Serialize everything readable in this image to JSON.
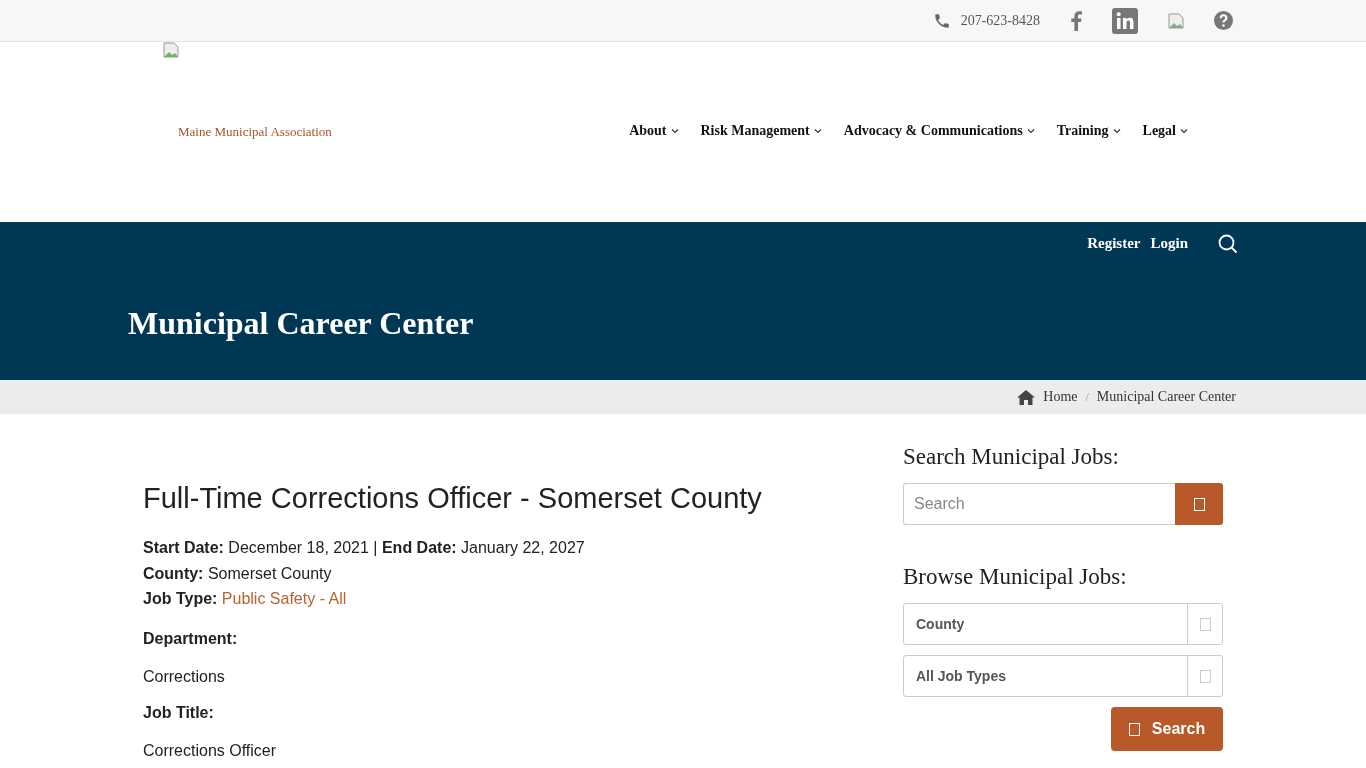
{
  "top_bar": {
    "phone": "207-623-8428"
  },
  "header": {
    "logo_text": "Maine Municipal Association",
    "nav": [
      {
        "label": "About"
      },
      {
        "label": "Risk Management"
      },
      {
        "label": "Advocacy & Communications"
      },
      {
        "label": "Training"
      },
      {
        "label": "Legal"
      }
    ]
  },
  "account_bar": {
    "links": [
      "Register",
      "Login"
    ]
  },
  "hero": {
    "title": "Municipal Career Center"
  },
  "breadcrumb": {
    "items": [
      "Home",
      "Municipal Career Center"
    ],
    "separator": "/"
  },
  "job": {
    "title": "Full-Time Corrections Officer - Somerset County",
    "meta": [
      "**Start Date:** December 18, 2021 | **End Date:** January 22, 2027",
      "**County:** Somerset County"
    ],
    "job_type": {
      "label": "Job Type:",
      "value": "Public Safety - All"
    },
    "sections": [
      {
        "heading": "Department:",
        "text": "Corrections"
      },
      {
        "heading": "Job Title:",
        "text": "Corrections Officer"
      }
    ]
  },
  "sidebar": {
    "search_heading": "Search Municipal Jobs:",
    "search_placeholder": "Search",
    "browse_heading": "Browse Municipal Jobs:",
    "selects": [
      "County",
      "All Job Types"
    ],
    "button": "Search"
  }
}
